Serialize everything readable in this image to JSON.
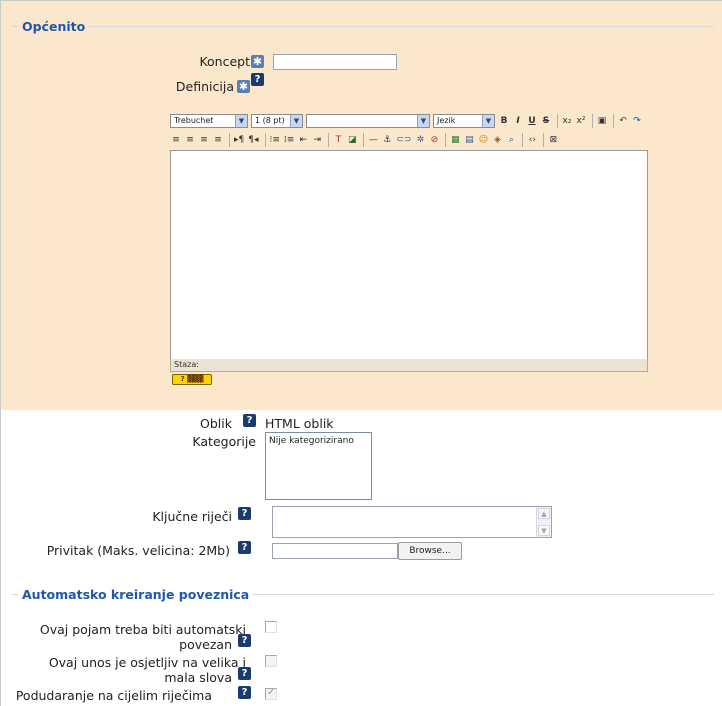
{
  "general": {
    "legend": "Općenito",
    "concept_label": "Koncept",
    "concept_value": "",
    "definition_label": "Definicija"
  },
  "editor": {
    "font_family": "Trebuchet",
    "font_size": "1 (8 pt)",
    "style": "",
    "language": "Jezik",
    "status_label": "Staza:",
    "help_button": "?"
  },
  "format": {
    "label": "Oblik",
    "value": "HTML oblik"
  },
  "categories": {
    "label": "Kategorije",
    "options": [
      "Nije kategorizirano"
    ]
  },
  "keywords": {
    "label": "Ključne riječi",
    "value": ""
  },
  "attachment": {
    "label": "Privitak (Maks. velicina: 2Mb)",
    "value": "",
    "browse_label": "Browse..."
  },
  "autolink": {
    "legend": "Automatsko kreiranje poveznica",
    "item1_line1": "Ovaj pojam treba biti automatski",
    "item1_line2": "povezan",
    "item2_line1": "Ovaj unos je osjetljiv na velika i",
    "item2_line2": "mala slova",
    "item3": "Podudaranje na cijelim riječima"
  },
  "icons": {
    "help": "?",
    "required": "✱",
    "check": "✓"
  }
}
